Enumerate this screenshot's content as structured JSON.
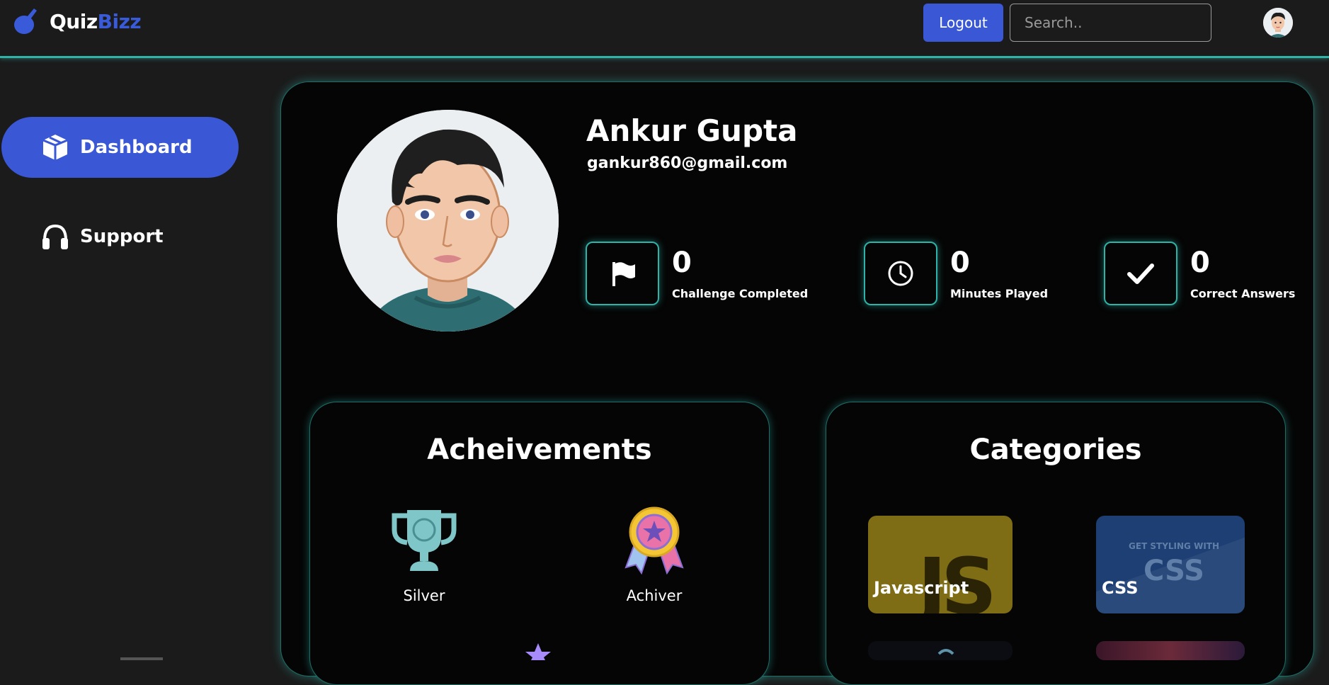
{
  "header": {
    "logo_part1": "Quiz",
    "logo_part2": "Bizz",
    "logout_label": "Logout",
    "search_placeholder": "Search.."
  },
  "sidebar": {
    "items": [
      {
        "label": "Dashboard",
        "icon": "cube-icon",
        "active": true
      },
      {
        "label": "Support",
        "icon": "headphones-icon",
        "active": false
      }
    ]
  },
  "profile": {
    "name": "Ankur Gupta",
    "email": "gankur860@gmail.com"
  },
  "stats": [
    {
      "value": "0",
      "label": "Challenge Completed",
      "icon": "flag-icon"
    },
    {
      "value": "0",
      "label": "Minutes Played",
      "icon": "clock-icon"
    },
    {
      "value": "0",
      "label": "Correct Answers",
      "icon": "checkmark-icon"
    }
  ],
  "achievements": {
    "title": "Acheivements",
    "items": [
      {
        "label": "Silver",
        "icon": "trophy-icon"
      },
      {
        "label": "Achiver",
        "icon": "medal-icon"
      }
    ]
  },
  "categories": {
    "title": "Categories",
    "items": [
      {
        "label": "Javascript",
        "tile_text": "JS"
      },
      {
        "label": "CSS",
        "tile_text": "GET STYLING WITH CSS"
      }
    ]
  },
  "colors": {
    "accent": "#3a57d6",
    "glow": "#2fb3a8",
    "background": "#1b1b1b"
  }
}
